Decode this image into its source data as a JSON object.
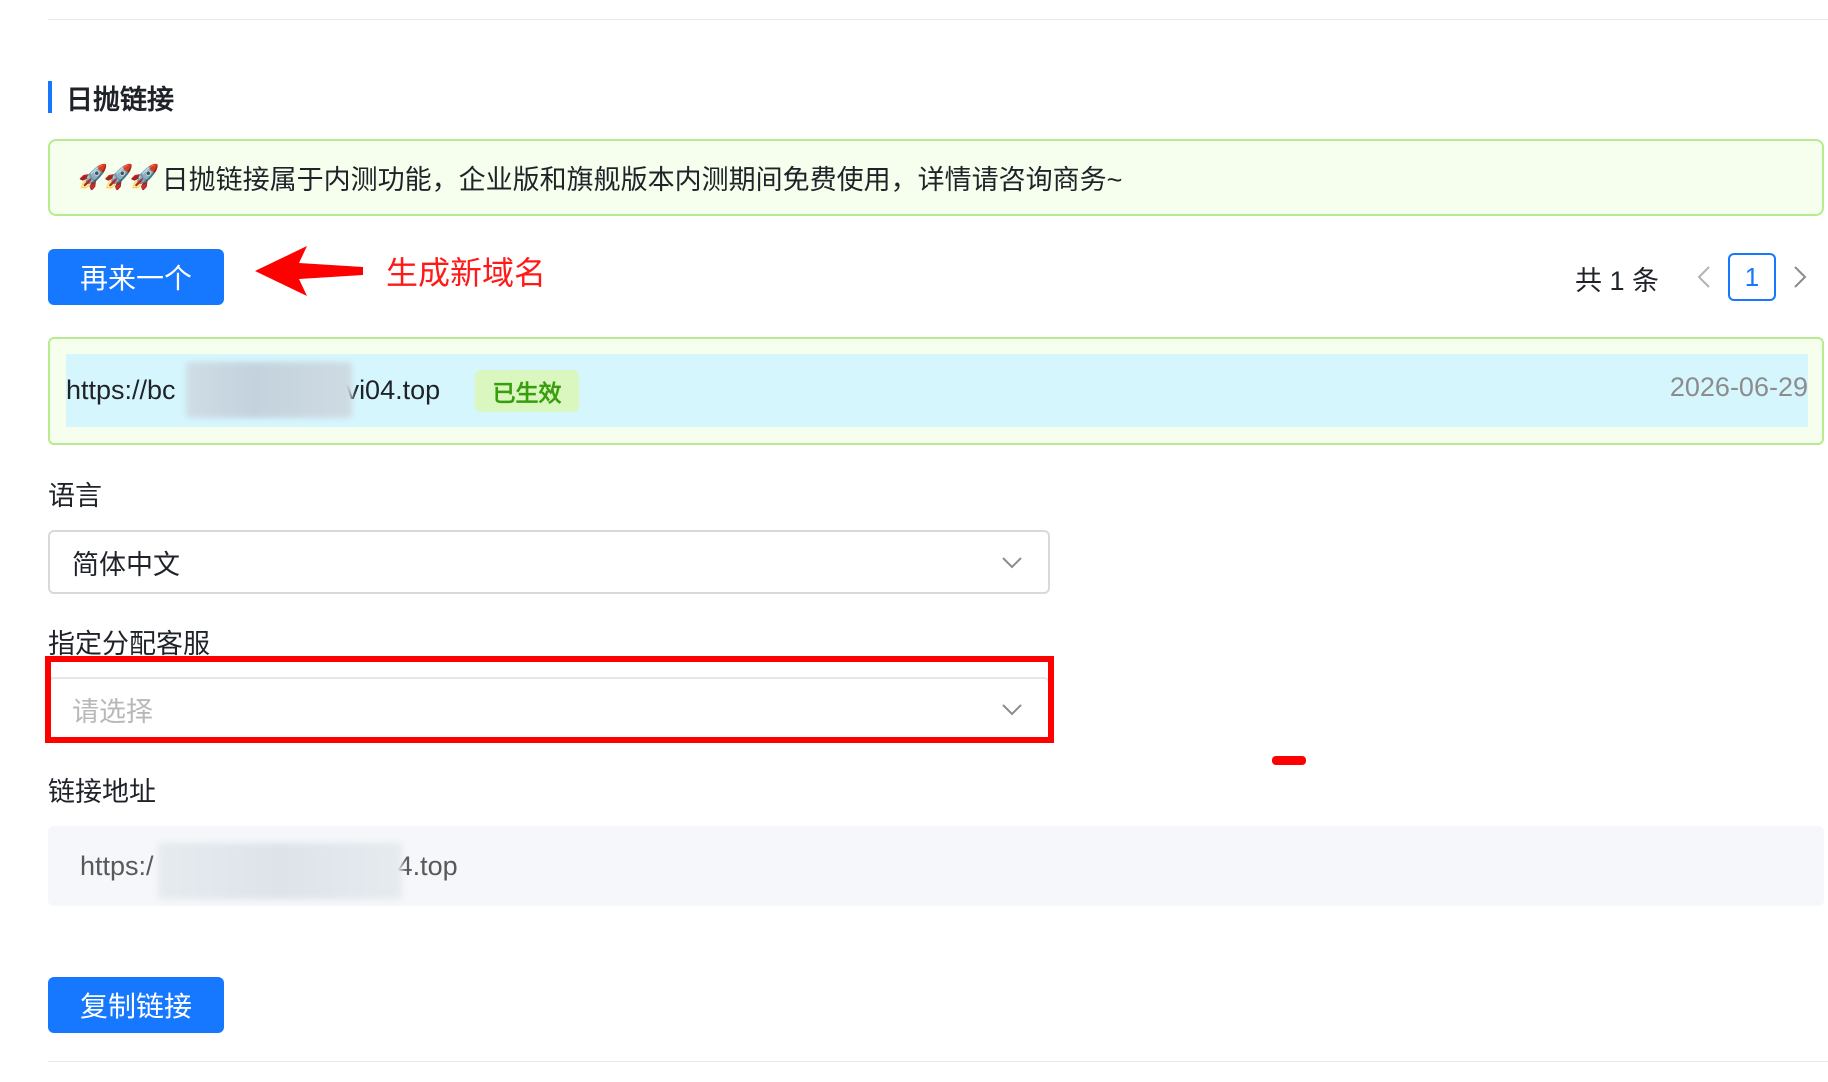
{
  "section": {
    "title": "日抛链接"
  },
  "notice": {
    "rockets": "🚀🚀🚀",
    "text": "日抛链接属于内测功能，企业版和旗舰版本内测期间免费使用，详情请咨询商务~"
  },
  "toolbar": {
    "again_label": "再来一个"
  },
  "annotation": {
    "text": "生成新域名",
    "color": "#ff1a1a"
  },
  "pagination": {
    "total_text": "共 1 条",
    "current_page": "1",
    "prev_icon": "chevron-left-icon",
    "next_icon": "chevron-right-icon"
  },
  "link_list": {
    "items": [
      {
        "url_prefix": "https://bc",
        "url_suffix": "vi04.top",
        "status": "已生效",
        "date": "2026-06-29"
      }
    ]
  },
  "form": {
    "language": {
      "label": "语言",
      "value": "简体中文"
    },
    "agent": {
      "label": "指定分配客服",
      "placeholder": "请选择"
    },
    "link_address": {
      "label": "链接地址",
      "prefix": "https:/",
      "suffix": "4.top"
    }
  },
  "actions": {
    "copy_label": "复制链接"
  },
  "colors": {
    "primary": "#1677ff",
    "success_bg": "#f6ffed",
    "success_border": "#b7eb8f",
    "tag_text": "#389e0d",
    "highlight": "#ff0000"
  }
}
